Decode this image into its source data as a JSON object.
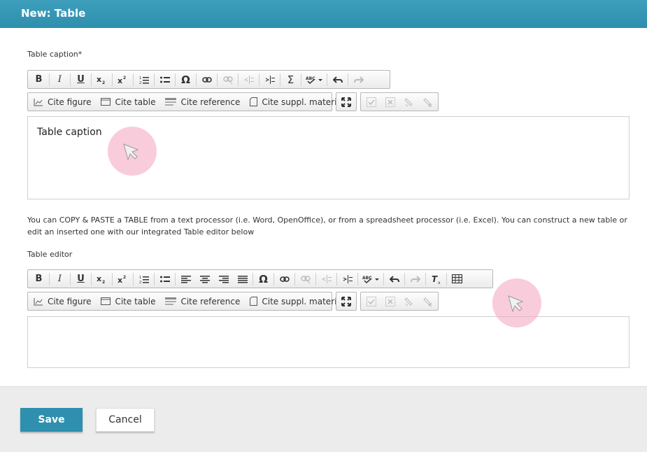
{
  "header": {
    "title": "New: Table"
  },
  "caption_section": {
    "label": "Table caption*",
    "editor_text": "Table caption"
  },
  "help_text": "You can COPY & PASTE a TABLE from a text processor (i.e. Word, OpenOffice), or from a spreadsheet processor (i.e. Excel). You can construct a new table or edit an inserted one with our integrated Table editor below",
  "table_section": {
    "label": "Table editor"
  },
  "cite_toolbar": {
    "cite_figure": "Cite figure",
    "cite_table": "Cite table",
    "cite_reference": "Cite reference",
    "cite_suppl": "Cite suppl. material"
  },
  "format_toolbar": {
    "bold": "B",
    "italic": "I",
    "underline": "U",
    "omega": "Ω",
    "sigma": "Σ"
  },
  "footer": {
    "save_label": "Save",
    "cancel_label": "Cancel"
  },
  "colors": {
    "accent": "#2e8fae",
    "header": "#3e9fbc",
    "highlight": "#f5aac3"
  }
}
